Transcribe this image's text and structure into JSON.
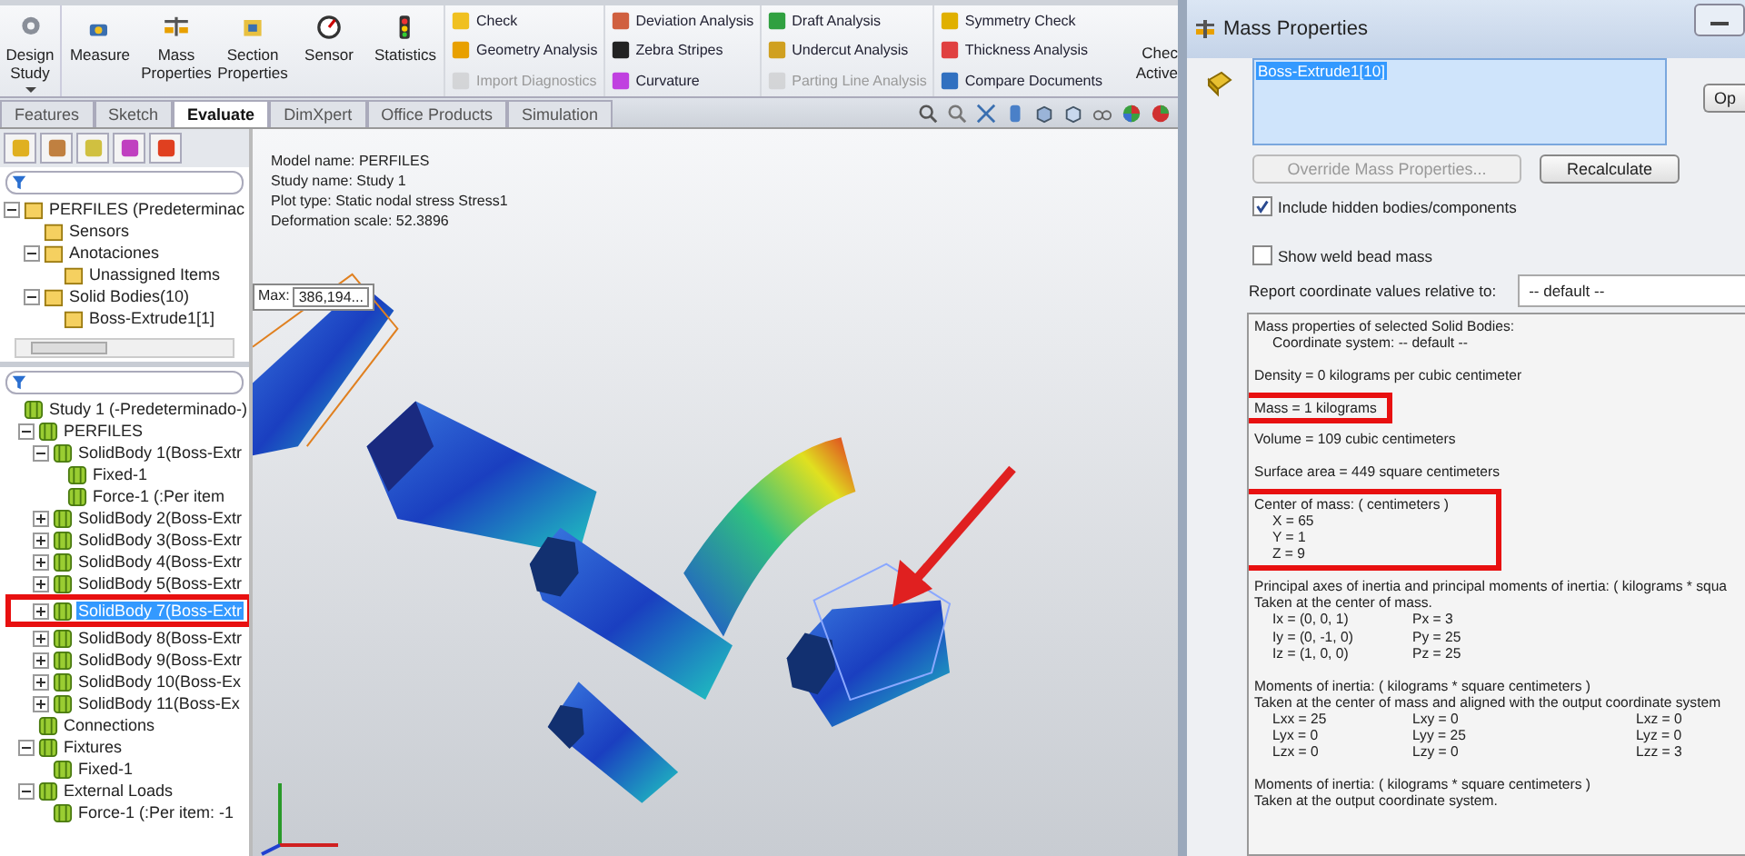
{
  "ribbon": {
    "large_buttons": [
      {
        "label": "Design Study",
        "dropdown": true
      },
      {
        "label": "Measure",
        "dropdown": false
      },
      {
        "label": "Mass Properties",
        "dropdown": false
      },
      {
        "label": "Section Properties",
        "dropdown": false
      },
      {
        "label": "Sensor",
        "dropdown": false
      },
      {
        "label": "Statistics",
        "dropdown": false
      }
    ],
    "small_columns": [
      [
        {
          "label": "Check",
          "disabled": false
        },
        {
          "label": "Geometry Analysis",
          "disabled": false
        },
        {
          "label": "Import Diagnostics",
          "disabled": true
        }
      ],
      [
        {
          "label": "Deviation Analysis",
          "disabled": false
        },
        {
          "label": "Zebra Stripes",
          "disabled": false
        },
        {
          "label": "Curvature",
          "disabled": false
        }
      ],
      [
        {
          "label": "Draft Analysis",
          "disabled": false
        },
        {
          "label": "Undercut Analysis",
          "disabled": false
        },
        {
          "label": "Parting Line Analysis",
          "disabled": true
        }
      ],
      [
        {
          "label": "Symmetry Check",
          "disabled": false
        },
        {
          "label": "Thickness Analysis",
          "disabled": false
        },
        {
          "label": "Compare Documents",
          "disabled": false
        }
      ]
    ],
    "cut_button": "Chec Active"
  },
  "tabs": [
    {
      "label": "Features",
      "selected": false
    },
    {
      "label": "Sketch",
      "selected": false
    },
    {
      "label": "Evaluate",
      "selected": true
    },
    {
      "label": "DimXpert",
      "selected": false
    },
    {
      "label": "Office Products",
      "selected": false
    },
    {
      "label": "Simulation",
      "selected": false
    }
  ],
  "feature_tree": [
    {
      "label": "PERFILES  (Predeterminac",
      "expanded": true,
      "children": [
        {
          "label": "Sensors"
        },
        {
          "label": "Anotaciones",
          "expanded": true,
          "children": [
            {
              "label": "Unassigned Items"
            }
          ]
        },
        {
          "label": "Solid Bodies(10)",
          "expanded": true,
          "children": [
            {
              "label": "Boss-Extrude1[1]"
            }
          ]
        }
      ]
    }
  ],
  "simulation_tree": [
    {
      "label": "Study 1 (-Predeterminado-)",
      "selected": false,
      "annotated": false,
      "children": [
        {
          "label": "PERFILES",
          "selected": false,
          "annotated": false,
          "expanded": true,
          "children": [
            {
              "label": "SolidBody 1(Boss-Extr",
              "selected": false,
              "annotated": false,
              "expanded": true,
              "children": [
                {
                  "label": "Fixed-1",
                  "selected": false,
                  "annotated": false
                },
                {
                  "label": "Force-1 (:Per item",
                  "selected": false,
                  "annotated": false
                }
              ]
            },
            {
              "label": "SolidBody 2(Boss-Extr",
              "selected": false,
              "annotated": false,
              "expanded": false
            },
            {
              "label": "SolidBody 3(Boss-Extr",
              "selected": false,
              "annotated": false,
              "expanded": false
            },
            {
              "label": "SolidBody 4(Boss-Extr",
              "selected": false,
              "annotated": false,
              "expanded": false
            },
            {
              "label": "SolidBody 5(Boss-Extr",
              "selected": false,
              "annotated": false,
              "expanded": false
            },
            {
              "label": "SolidBody 7(Boss-Extr",
              "selected": true,
              "annotated": true,
              "expanded": false
            },
            {
              "label": "SolidBody 8(Boss-Extr",
              "selected": false,
              "annotated": false,
              "expanded": false
            },
            {
              "label": "SolidBody 9(Boss-Extr",
              "selected": false,
              "annotated": false,
              "expanded": false
            },
            {
              "label": "SolidBody 10(Boss-Ex",
              "selected": false,
              "annotated": false,
              "expanded": false
            },
            {
              "label": "SolidBody 11(Boss-Ex",
              "selected": false,
              "annotated": false,
              "expanded": false
            }
          ]
        },
        {
          "label": "Connections",
          "selected": false,
          "annotated": false
        },
        {
          "label": "Fixtures",
          "selected": false,
          "annotated": false,
          "expanded": true,
          "children": [
            {
              "label": "Fixed-1",
              "selected": false,
              "annotated": false
            }
          ]
        },
        {
          "label": "External Loads",
          "selected": false,
          "annotated": false,
          "expanded": true,
          "children": [
            {
              "label": "Force-1 (:Per item: -1",
              "selected": false,
              "annotated": false
            }
          ]
        }
      ]
    }
  ],
  "viewport": {
    "info_lines": [
      "Model name: PERFILES",
      "Study name: Study 1",
      "Plot type: Static nodal stress Stress1",
      "Deformation scale: 52.3896"
    ],
    "max_label": "Max:",
    "max_value": "386,194..."
  },
  "dialog": {
    "title": "Mass Properties",
    "selection": [
      {
        "label": "Boss-Extrude1[10]",
        "selected": true
      }
    ],
    "options_button": "Op",
    "override_button": {
      "label": "Override Mass Properties...",
      "disabled": true
    },
    "recalculate_button": "Recalculate",
    "checkboxes": [
      {
        "label": "Include hidden bodies/components",
        "checked": true
      },
      {
        "label": "Show weld bead mass",
        "checked": false
      }
    ],
    "relative_to": {
      "label": "Report coordinate values relative to:",
      "value": "-- default --"
    },
    "results": [
      {
        "annotated": false,
        "lines": [
          {
            "indent": false,
            "cells": [
              "Mass properties of selected Solid Bodies:"
            ]
          },
          {
            "indent": true,
            "cells": [
              "Coordinate system: -- default --"
            ]
          }
        ]
      },
      {
        "annotated": false,
        "lines": [
          {
            "indent": false,
            "cells": [
              "Density = 0 kilograms per  cubic centimeter"
            ]
          }
        ]
      },
      {
        "annotated": true,
        "lines": [
          {
            "indent": false,
            "cells": [
              "Mass = 1 kilograms"
            ]
          }
        ]
      },
      {
        "annotated": false,
        "lines": [
          {
            "indent": false,
            "cells": [
              "Volume = 109  cubic centimeters"
            ]
          }
        ]
      },
      {
        "annotated": false,
        "lines": [
          {
            "indent": false,
            "cells": [
              "Surface area = 449  square centimeters"
            ]
          }
        ]
      },
      {
        "annotated": true,
        "lines": [
          {
            "indent": false,
            "cells": [
              "Center of mass: ( centimeters )"
            ]
          },
          {
            "indent": true,
            "cells": [
              "X = 65"
            ]
          },
          {
            "indent": true,
            "cells": [
              "Y = 1"
            ]
          },
          {
            "indent": true,
            "cells": [
              "Z = 9"
            ]
          }
        ]
      },
      {
        "annotated": false,
        "lines": [
          {
            "indent": false,
            "cells": [
              "Principal axes of inertia and principal moments of inertia: ( kilograms *  squa"
            ]
          },
          {
            "indent": false,
            "cells": [
              "Taken at the center of mass."
            ]
          },
          {
            "indent": true,
            "cells": [
              "Ix = (0, 0, 1)",
              "Px = 3"
            ]
          },
          {
            "indent": true,
            "cells": [
              "Iy = (0, -1, 0)",
              "Py = 25"
            ]
          },
          {
            "indent": true,
            "cells": [
              "Iz = (1, 0, 0)",
              "Pz = 25"
            ]
          }
        ]
      },
      {
        "annotated": false,
        "lines": [
          {
            "indent": false,
            "cells": [
              "Moments of inertia: ( kilograms *  square centimeters )"
            ]
          },
          {
            "indent": false,
            "cells": [
              "Taken at the center of mass and aligned with the output coordinate system"
            ]
          },
          {
            "indent": true,
            "cells": [
              "Lxx = 25",
              "Lxy = 0",
              "Lxz = 0"
            ]
          },
          {
            "indent": true,
            "cells": [
              "Lyx = 0",
              "Lyy = 25",
              "Lyz = 0"
            ]
          },
          {
            "indent": true,
            "cells": [
              "Lzx = 0",
              "Lzy = 0",
              "Lzz = 3"
            ]
          }
        ]
      },
      {
        "annotated": false,
        "lines": [
          {
            "indent": false,
            "cells": [
              "Moments of inertia: ( kilograms *  square centimeters )"
            ]
          },
          {
            "indent": false,
            "cells": [
              "Taken at the output coordinate system."
            ]
          }
        ]
      }
    ]
  }
}
